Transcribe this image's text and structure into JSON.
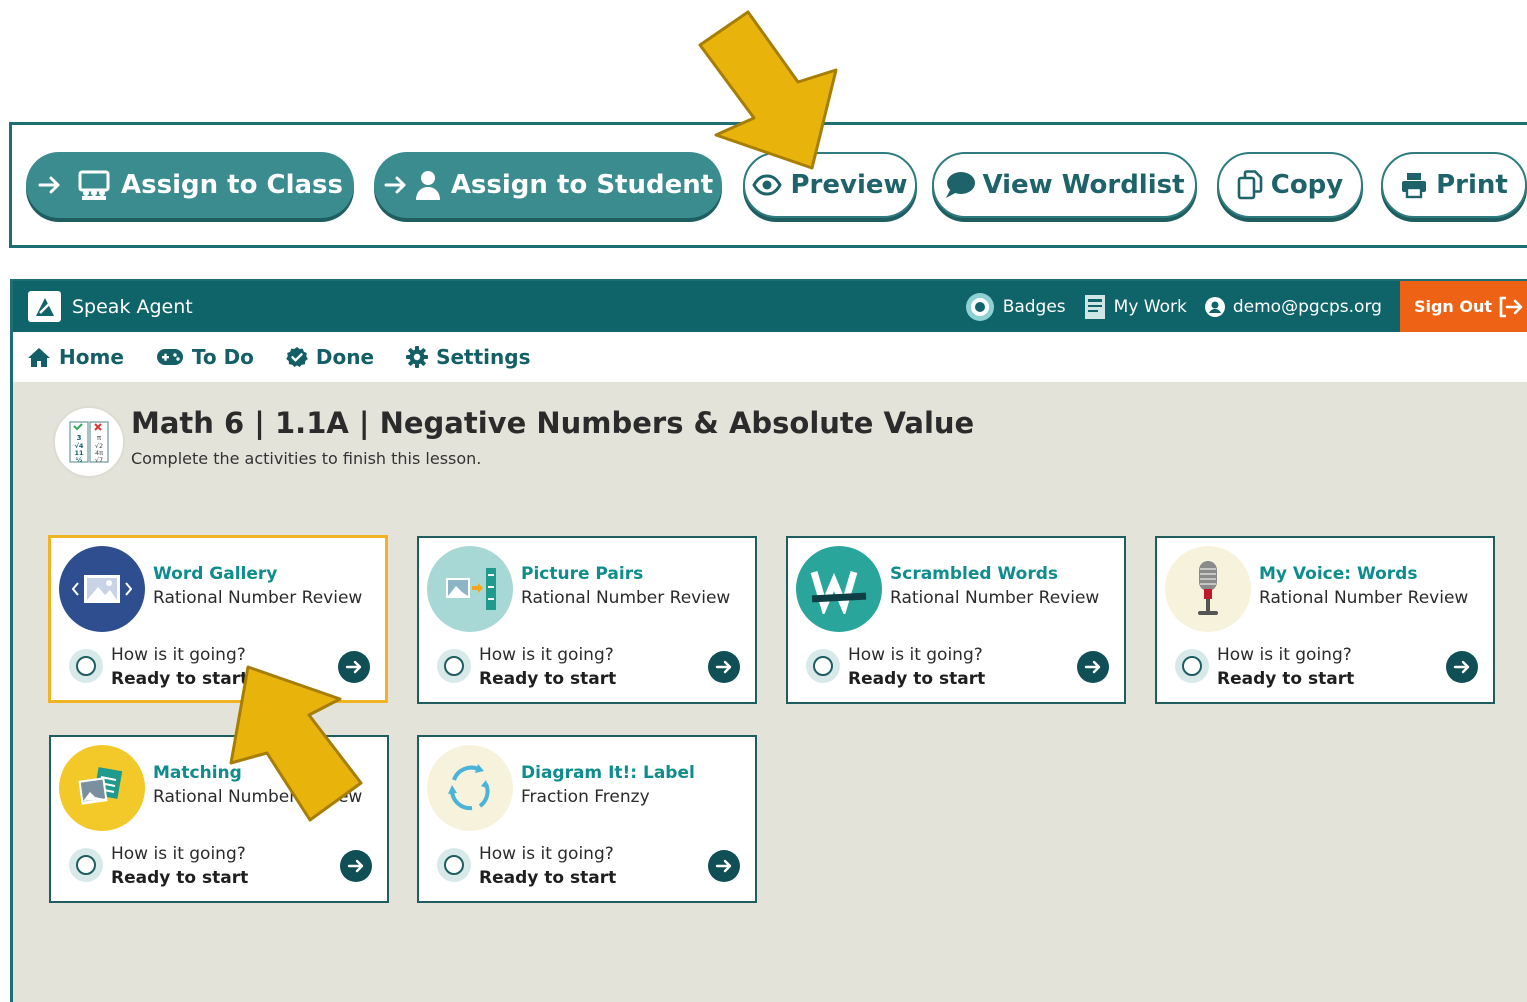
{
  "toolbar": {
    "assign_class": "Assign to Class",
    "assign_student": "Assign to Student",
    "preview": "Preview",
    "view_wordlist": "View Wordlist",
    "copy": "Copy",
    "print": "Print"
  },
  "appbar": {
    "brand": "Speak Agent",
    "badges": "Badges",
    "my_work": "My Work",
    "user_email": "demo@pgcps.org",
    "sign_out": "Sign Out"
  },
  "nav": {
    "home": "Home",
    "todo": "To Do",
    "done": "Done",
    "settings": "Settings"
  },
  "lesson": {
    "title": "Math 6 | 1.1A | Negative Numbers & Absolute Value",
    "subtitle": "Complete the activities to finish this lesson.",
    "icon_glyphs": [
      "3",
      "π",
      "√4",
      "√2",
      "11",
      "4π",
      "½",
      "√7"
    ]
  },
  "activities": [
    {
      "title": "Word Gallery",
      "subtitle": "Rational Number Review",
      "question": "How is it going?",
      "status": "Ready to start",
      "selected": true
    },
    {
      "title": "Picture Pairs",
      "subtitle": "Rational Number Review",
      "question": "How is it going?",
      "status": "Ready to start",
      "selected": false
    },
    {
      "title": "Scrambled Words",
      "subtitle": "Rational Number Review",
      "question": "How is it going?",
      "status": "Ready to start",
      "selected": false
    },
    {
      "title": "My Voice: Words",
      "subtitle": "Rational Number Review",
      "question": "How is it going?",
      "status": "Ready to start",
      "selected": false
    },
    {
      "title": "Matching",
      "subtitle": "Rational Number Review",
      "question": "How is it going?",
      "status": "Ready to start",
      "selected": false
    },
    {
      "title": "Diagram It!: Label",
      "subtitle": "Fraction Frenzy",
      "question": "How is it going?",
      "status": "Ready to start",
      "selected": false
    }
  ],
  "colors": {
    "teal_dark": "#0e6468",
    "teal_button": "#3a8c8f",
    "accent_orange": "#ee6215",
    "highlight_gold": "#f0b323",
    "content_bg": "#e4e3da"
  }
}
